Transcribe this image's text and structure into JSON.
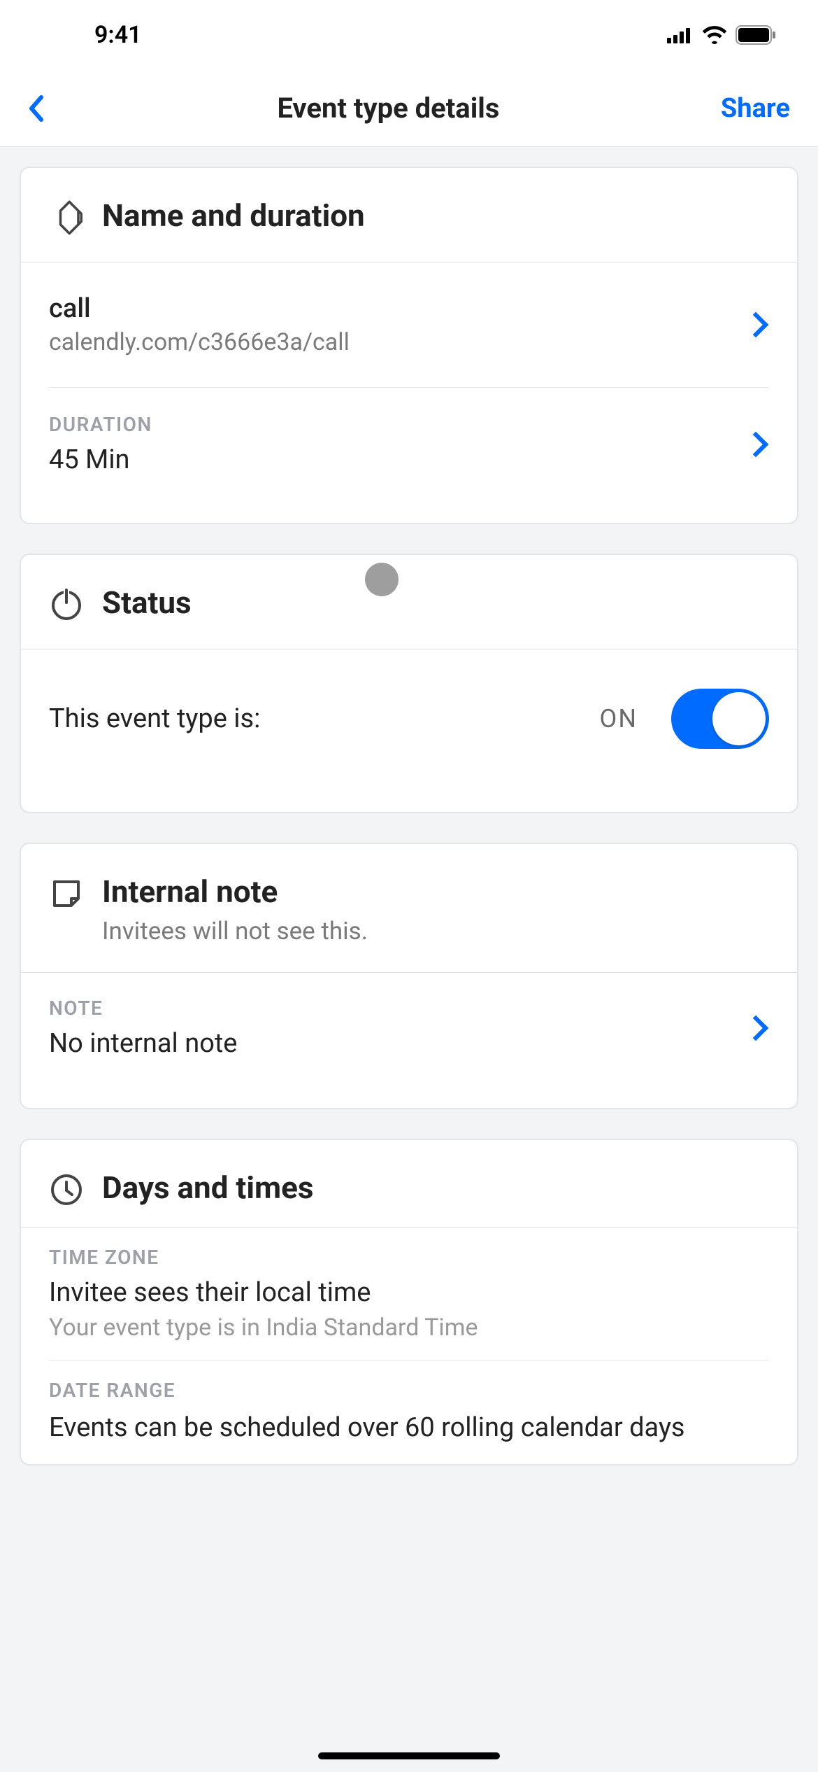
{
  "statusBar": {
    "time": "9:41"
  },
  "nav": {
    "title": "Event type details",
    "share": "Share"
  },
  "nameDuration": {
    "header": "Name and duration",
    "nameValue": "call",
    "url": "calendly.com/c3666e3a/call",
    "durationLabel": "DURATION",
    "durationValue": "45 Min"
  },
  "status": {
    "header": "Status",
    "prompt": "This event type is:",
    "state": "ON"
  },
  "internalNote": {
    "header": "Internal note",
    "sub": "Invitees will not see this.",
    "label": "NOTE",
    "value": "No internal note"
  },
  "daysTimes": {
    "header": "Days and times",
    "tzLabel": "TIME ZONE",
    "tzValue": "Invitee sees their local time",
    "tzSub": "Your event type is in India Standard Time",
    "rangeLabel": "DATE RANGE",
    "rangeValue": "Events can be scheduled over 60 rolling calendar days"
  }
}
